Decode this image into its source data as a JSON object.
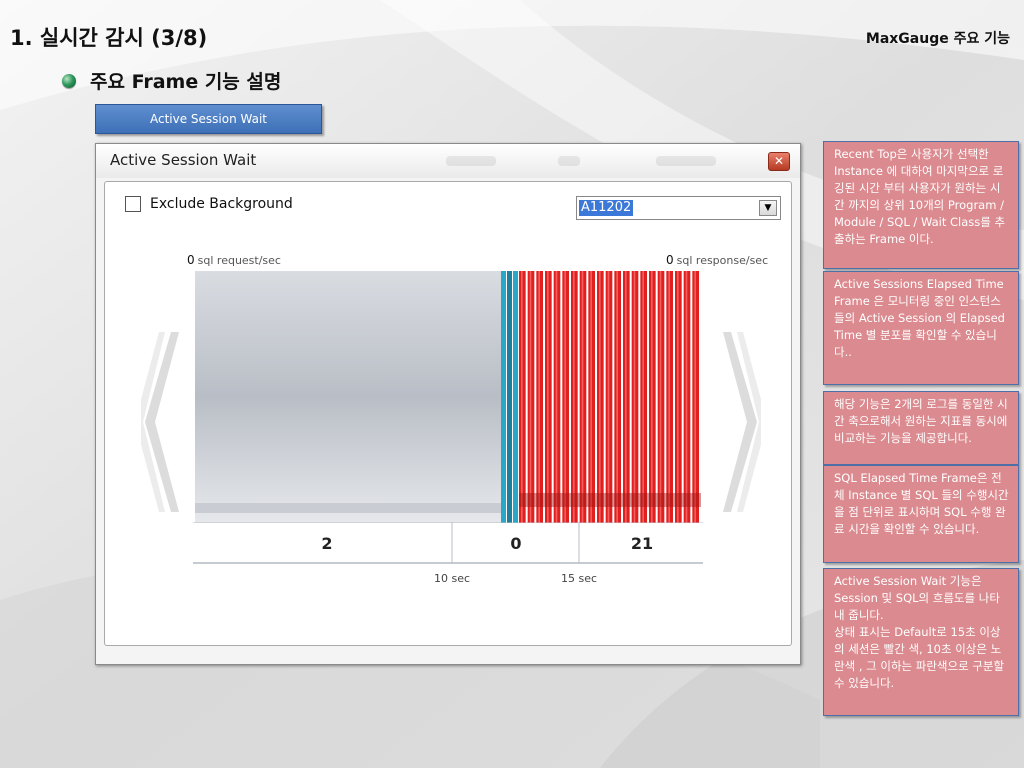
{
  "slide": {
    "title": "1. 실시간 감시 (3/8)",
    "tag": "MaxGauge  주요 기능",
    "bullet": "주요 Frame 기능 설명",
    "tab_label": "Active Session Wait"
  },
  "window": {
    "title": "Active Session Wait",
    "close_symbol": "✕",
    "checkbox_label": "Exclude Background",
    "checkbox_checked": false,
    "instance_select": "A11202",
    "dropdown_arrow": "▼",
    "left_metric_value": "0",
    "left_metric_label": "sql request/sec",
    "right_metric_value": "0",
    "right_metric_label": "sql response/sec",
    "bins": [
      {
        "count": "2",
        "color": "#c5c9d0"
      },
      {
        "count": "0",
        "color": "#2aa7c7"
      },
      {
        "count": "21",
        "color": "#e11f1f"
      }
    ],
    "ticks": [
      "10 sec",
      "15 sec"
    ]
  },
  "notes": [
    "Recent Top은 사용자가 선택한 Instance 에 대하여 마지막으로 로깅된 시간 부터 사용자가 원하는 시간 까지의 상위 10개의 Program / Module / SQL / Wait Class를 추출하는 Frame 이다.",
    "Active Sessions Elapsed Time Frame 은 모니터링 중인 인스턴스들의 Active Session 의 Elapsed Time 별 분포를 확인할 수 있습니다..",
    "해당 기능은 2개의 로그를 동일한 시간 축으로해서 원하는 지표를 동시에 비교하는 기능을 제공합니다.",
    "SQL Elapsed Time Frame은 전체 Instance 별 SQL 들의 수행시간을 점 단위로 표시하며 SQL 수행 완료 시간을 확인할 수 있습니다.",
    "Active Session Wait 기능은 Session 및 SQL의 흐름도를 나타내 줍니다.\n상태 표시는 Default로 15초 이상의 세션은 빨간 색, 10초 이상은 노란색 , 그 이하는 파란색으로 구분할 수 있습니다."
  ]
}
